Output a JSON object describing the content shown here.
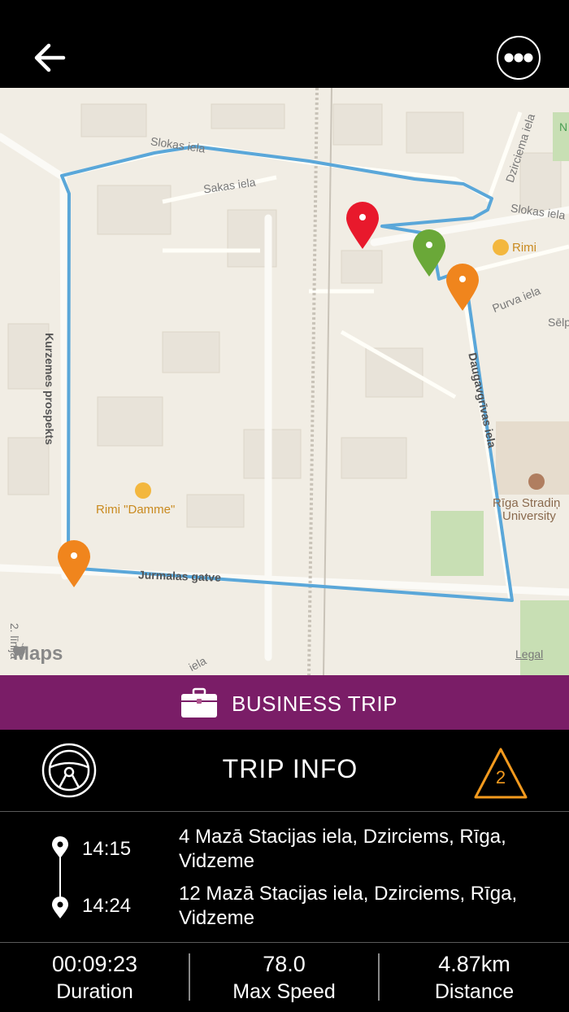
{
  "map": {
    "streets": {
      "slokas_top": "Slokas iela",
      "sakas": "Sakas iela",
      "dzirciema": "Dzirciema iela",
      "slokas_right": "Slokas iela",
      "purva": "Purva iela",
      "selp": "Sēlp",
      "kurzemes": "Kurzemes prospekts",
      "jurmalas": "Jurmalas gatve",
      "bold_street": "Daugavgrīvas iela",
      "linija": "2. līnija",
      "iela_bottom": "iela",
      "corner_n": "N"
    },
    "pois": {
      "rimi": "Rimi",
      "rimi_damme": "Rimi \"Damme\"",
      "riga_stradins_1": "Rīga Stradiņ",
      "riga_stradins_2": "University"
    },
    "attribution": "Maps",
    "legal": "Legal",
    "route_color": "#5aa7d9",
    "markers": [
      "red",
      "green",
      "orange",
      "orange"
    ]
  },
  "banner": {
    "label": "BUSINESS TRIP",
    "color": "#7a1d67"
  },
  "trip_info": {
    "title": "TRIP INFO",
    "warning_count": "2",
    "warning_color": "#f39a1e"
  },
  "route": {
    "start": {
      "time": "14:15",
      "address": "4 Mazā Stacijas iela, Dzirciems, Rīga, Vidzeme"
    },
    "end": {
      "time": "14:24",
      "address": "12 Mazā Stacijas iela, Dzirciems, Rīga, Vidzeme"
    }
  },
  "stats": {
    "duration": {
      "value": "00:09:23",
      "label": "Duration"
    },
    "max_speed": {
      "value": "78.0",
      "label": "Max Speed"
    },
    "distance": {
      "value": "4.87km",
      "label": "Distance"
    }
  }
}
